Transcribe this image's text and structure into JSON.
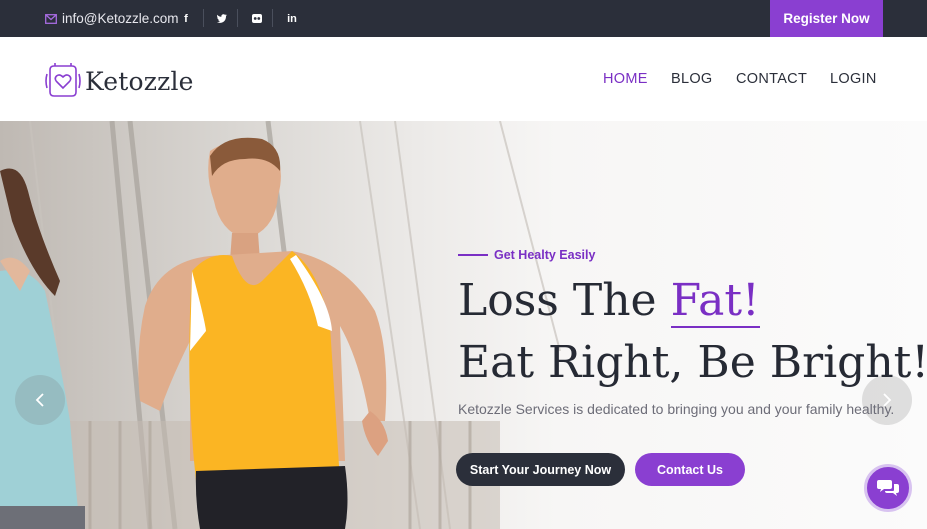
{
  "topbar": {
    "email": "info@Ketozzle.com",
    "social_icons": [
      "facebook-icon",
      "twitter-icon",
      "flickr-icon",
      "linkedin-icon"
    ],
    "social_glyphs": [
      "f",
      "t",
      "fl",
      "in"
    ],
    "register_label": "Register Now"
  },
  "header": {
    "logo_text": "Ketozzle",
    "nav": [
      "HOME",
      "BLOG",
      "CONTACT",
      "LOGIN"
    ],
    "active_nav": "HOME"
  },
  "hero": {
    "eyebrow": "Get Healty Easily",
    "headline_1_prefix": "Loss The ",
    "headline_1_accent": "Fat!",
    "headline_2": "Eat Right, Be Bright!",
    "subtext": "Ketozzle Services is dedicated to bringing you and your family healthy.",
    "primary_button": "Start Your Journey Now",
    "secondary_button": "Contact Us"
  },
  "colors": {
    "accent": "#8a3fd1",
    "dark": "#2b2f3a"
  }
}
